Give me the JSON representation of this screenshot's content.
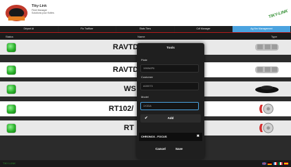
{
  "header": {
    "brand_title": "Tiky-Link",
    "brand_line2": "Fleet Manager",
    "brand_line3": "Solutions pour flottes",
    "corner_logo": "TIKY-LINK"
  },
  "menu": {
    "items": [
      {
        "label": "Départ At",
        "active": false
      },
      {
        "label": "Flo Trafficer",
        "active": false
      },
      {
        "label": "Etats Tiers",
        "active": false
      },
      {
        "label": "Cdf Manager",
        "active": false
      },
      {
        "label": "Ag Nm Management",
        "active": true
      }
    ]
  },
  "columns": {
    "status": "Status",
    "name": "Name",
    "type": "Type"
  },
  "rows": [
    {
      "plate": "RAVTD",
      "icon": "van-thumbnail-icon"
    },
    {
      "plate": "RAVTD",
      "icon": "van-thumbnail-icon"
    },
    {
      "plate": "WS",
      "icon": "car-thumbnail-icon"
    },
    {
      "plate": "RT102/",
      "icon": "brake-disc-icon"
    },
    {
      "plate": "RT",
      "icon": "brake-disc-icon"
    }
  ],
  "modal": {
    "title": "Tools",
    "plate_label": "Plate",
    "plate_value": "1969AP6",
    "customer_label": "Customer",
    "customer_value": "A00073",
    "model_label": "Model",
    "model_value": "1X33A",
    "add_label": "Add",
    "tag": "CHRONO3 - FOCUS",
    "cancel": "Cancel",
    "save": "Save"
  },
  "footer": {
    "brand": "TIKY-LINK"
  },
  "colors": {
    "accent": "#4aa3df",
    "status_green": "#2bb12b",
    "header_red": "#b31b1b"
  }
}
